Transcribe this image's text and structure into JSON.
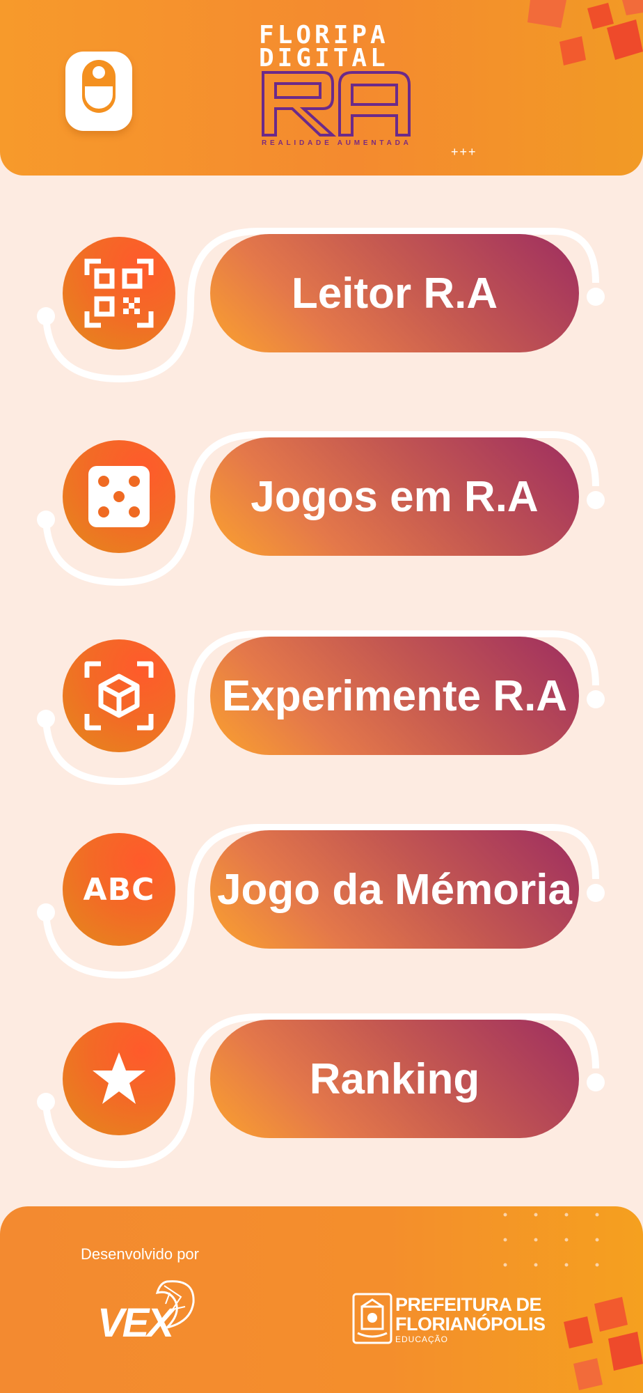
{
  "header": {
    "logo_line1": "FLORIPA",
    "logo_line2": "DIGITAL",
    "logo_big": "RA",
    "logo_subtitle": "REALIDADE AUMENTADA",
    "deco_plus": "+++"
  },
  "menu": {
    "items": [
      {
        "label": "Leitor R.A",
        "icon": "qr-code-icon"
      },
      {
        "label": "Jogos em R.A",
        "icon": "dice-icon"
      },
      {
        "label": "Experimente R.A",
        "icon": "ar-cube-icon"
      },
      {
        "label": "Jogo da Mémoria",
        "icon": "abc-icon",
        "icon_text": "ABC"
      },
      {
        "label": "Ranking",
        "icon": "star-icon"
      }
    ]
  },
  "footer": {
    "developed_by": "Desenvolvido por",
    "developer_logo": "VEX",
    "partner_line1": "PREFEITURA DE",
    "partner_line2": "FLORIANÓPOLIS",
    "partner_line3": "EDUCAÇÃO"
  },
  "colors": {
    "primary_orange": "#f48a2f",
    "accent_purple": "#9e2e60",
    "background": "#fdebe1"
  }
}
